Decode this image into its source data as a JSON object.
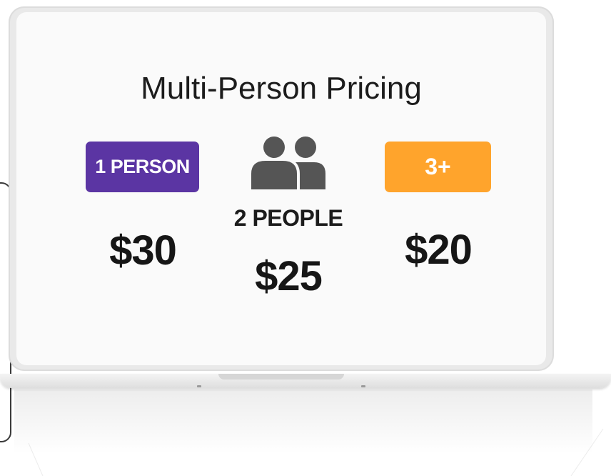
{
  "title": "Multi-Person Pricing",
  "tiers": [
    {
      "label": "1 PERSON",
      "price": "$30",
      "color": "#5b35a3"
    },
    {
      "label": "2 PEOPLE",
      "price": "$25",
      "icon": "people-icon"
    },
    {
      "label": "3+",
      "price": "$20",
      "color": "#ffa42c"
    }
  ]
}
